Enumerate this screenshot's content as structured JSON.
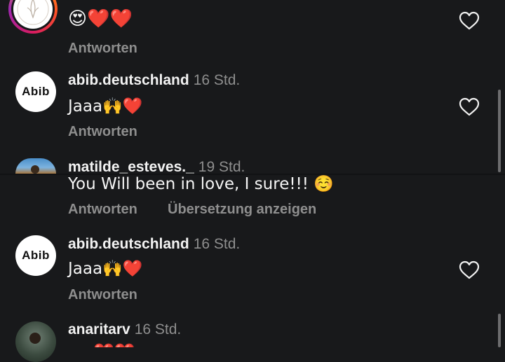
{
  "top_comment": {
    "emojis": "😍❤️❤️",
    "reply_label": "Antworten"
  },
  "comment_abib_1": {
    "username": "abib.deutschland",
    "time": "16 Std.",
    "avatar_text": "Abib",
    "text": "Jaaa🙌❤️",
    "reply_label": "Antworten"
  },
  "comment_matilde": {
    "username": "matilde_esteves._",
    "time": "19 Std.",
    "text": "You Will been in love, I sure!!! ☺️",
    "reply_label": "Antworten",
    "translate_label": "Übersetzung anzeigen"
  },
  "comment_abib_2": {
    "username": "abib.deutschland",
    "time": "16 Std.",
    "avatar_text": "Abib",
    "text": "Jaaa🙌❤️",
    "reply_label": "Antworten"
  },
  "comment_anarita": {
    "username": "anaritarv",
    "time": "16 Std.",
    "emojis": "❤️❤️"
  },
  "colors": {
    "background": "#18191b",
    "secondary_text": "#8e8e8e",
    "primary_text": "#f5f5f5",
    "story_ring_start": "#f9a825",
    "story_ring_end": "#d81b60"
  },
  "icons": {
    "like": "heart-outline-icon"
  }
}
